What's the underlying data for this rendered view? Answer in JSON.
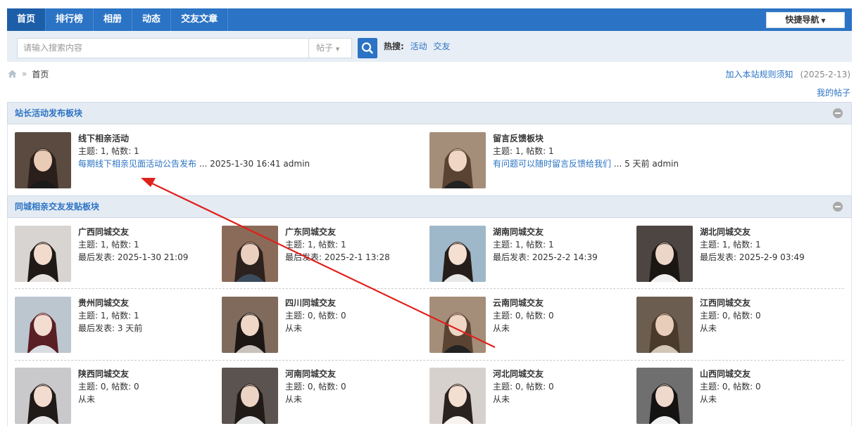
{
  "nav": {
    "items": [
      "首页",
      "排行榜",
      "相册",
      "动态",
      "交友文章"
    ],
    "quick_nav": "快捷导航"
  },
  "search": {
    "placeholder": "请输入搜索内容",
    "type": "帖子",
    "hot_label": "热搜:",
    "hot_links": [
      "活动",
      "交友"
    ]
  },
  "breadcrumb": {
    "home_icon": "home-icon",
    "current": "首页"
  },
  "notice": {
    "link": "加入本站规则须知",
    "date": "(2025-2-13)"
  },
  "my_posts": "我的帖子",
  "sections": [
    {
      "title": "站长活动发布板块",
      "forums": [
        {
          "name": "线下相亲活动",
          "stats": "主题: 1, 帖数: 1",
          "last_link": "每期线下相亲见面活动公告发布",
          "last_rest": " ... 2025-1-30 16:41 admin"
        },
        {
          "name": "留言反馈板块",
          "stats": "主题: 1, 帖数: 1",
          "last_link": "有问题可以随时留言反馈给我们",
          "last_rest": " ... 5 天前 admin"
        }
      ]
    },
    {
      "title": "同城相亲交友发贴板块",
      "forums": [
        {
          "name": "广西同城交友",
          "stats": "主题: 1, 帖数: 1",
          "last": "最后发表: 2025-1-30 21:09"
        },
        {
          "name": "广东同城交友",
          "stats": "主题: 1, 帖数: 1",
          "last": "最后发表: 2025-2-1 13:28"
        },
        {
          "name": "湖南同城交友",
          "stats": "主题: 1, 帖数: 1",
          "last": "最后发表: 2025-2-2 14:39"
        },
        {
          "name": "湖北同城交友",
          "stats": "主题: 1, 帖数: 1",
          "last": "最后发表: 2025-2-9 03:49"
        },
        {
          "name": "贵州同城交友",
          "stats": "主题: 1, 帖数: 1",
          "last": "最后发表: 3 天前"
        },
        {
          "name": "四川同城交友",
          "stats": "主题: 0, 帖数: 0",
          "last": "从未"
        },
        {
          "name": "云南同城交友",
          "stats": "主题: 0, 帖数: 0",
          "last": "从未"
        },
        {
          "name": "江西同城交友",
          "stats": "主题: 0, 帖数: 0",
          "last": "从未"
        },
        {
          "name": "陕西同城交友",
          "stats": "主题: 0, 帖数: 0",
          "last": "从未"
        },
        {
          "name": "河南同城交友",
          "stats": "主题: 0, 帖数: 0",
          "last": "从未"
        },
        {
          "name": "河北同城交友",
          "stats": "主题: 0, 帖数: 0",
          "last": "从未"
        },
        {
          "name": "山西同城交友",
          "stats": "主题: 0, 帖数: 0",
          "last": "从未"
        }
      ]
    }
  ],
  "colors": {
    "nav_bg": "#2b73c4",
    "link": "#2b73c4",
    "section_header_bg": "#e4ebf3",
    "annotation_arrow": "#e0201b"
  }
}
